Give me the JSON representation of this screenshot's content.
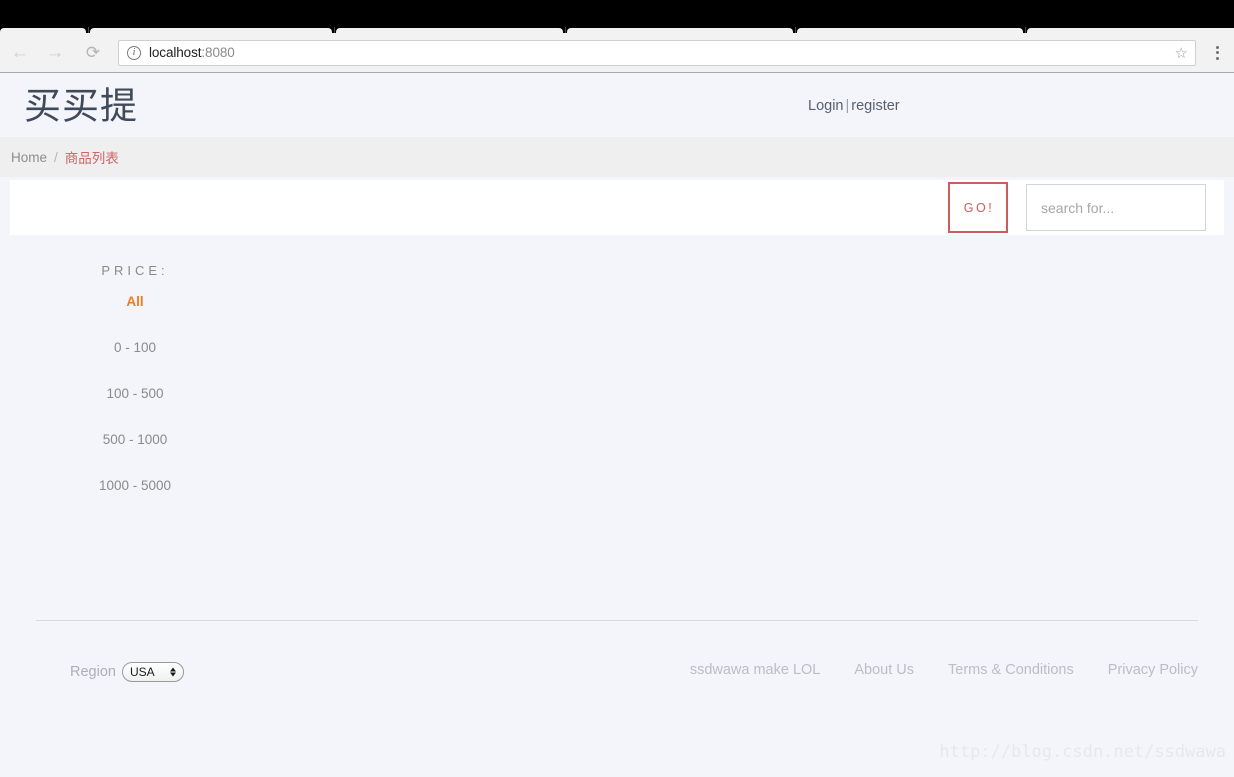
{
  "browser": {
    "back_icon": "back-arrow-icon",
    "forward_icon": "forward-arrow-icon",
    "reload_icon": "reload-icon",
    "security_icon": "info-circle-icon",
    "url_host": "localhost",
    "url_port": ":8080",
    "bookmark_icon": "star-icon",
    "menu_icon": "three-dot-menu-icon"
  },
  "header": {
    "logo": "买买提",
    "login_label": "Login",
    "separator": "|",
    "register_label": "register"
  },
  "breadcrumb": {
    "home_label": "Home",
    "separator": "/",
    "current_label": "商品列表"
  },
  "search": {
    "go_label": "GO!",
    "placeholder": "search for...",
    "value": ""
  },
  "filter": {
    "title": "PRICE:",
    "items": [
      {
        "label": "All",
        "active": true
      },
      {
        "label": "0 - 100",
        "active": false
      },
      {
        "label": "100 - 500",
        "active": false
      },
      {
        "label": "500 - 1000",
        "active": false
      },
      {
        "label": "1000 - 5000",
        "active": false
      }
    ]
  },
  "footer": {
    "region_label": "Region",
    "region_value": "USA",
    "region_options": [
      "USA"
    ],
    "links": [
      "ssdwawa make LOL",
      "About Us",
      "Terms & Conditions",
      "Privacy Policy"
    ]
  },
  "watermark": "http://blog.csdn.net/ssdwawa",
  "colors": {
    "page_background": "#f4f5fa",
    "breadcrumb_background": "#efefef",
    "accent_orange": "#f07c1e",
    "accent_red": "#cd5c5c",
    "breadcrumb_current": "#cc6666",
    "logo_text": "#3f4a5a"
  }
}
